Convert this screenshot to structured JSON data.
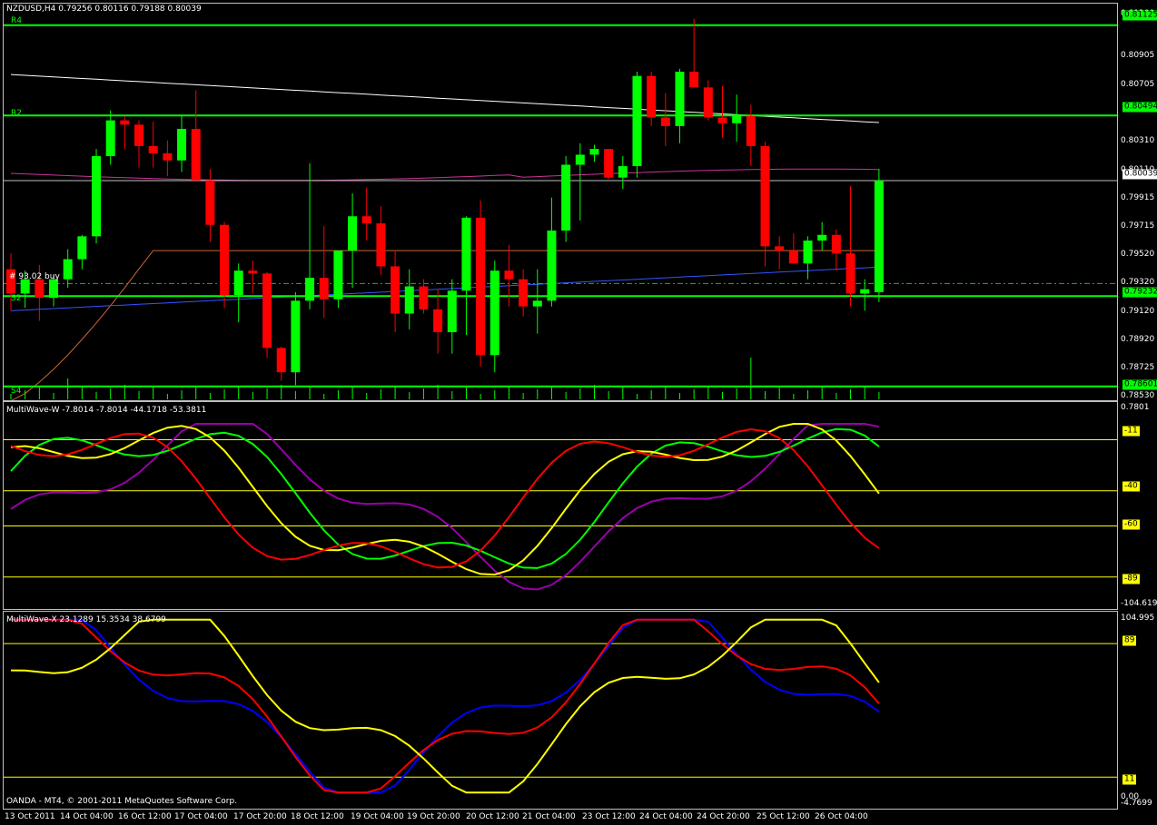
{
  "window": {
    "symbol_title": "NZDUSD,H4  0.79256 0.80116 0.79188 0.80039",
    "copyright": "OANDA - MT4, © 2001-2011 MetaQuotes Software Corp."
  },
  "colors": {
    "bull": "#00ff00",
    "bear": "#ff0000",
    "level": "#00ff00",
    "ind_level": "#ffff00",
    "purple": "#9900aa",
    "blue": "#0000ff",
    "yellow": "#ffff00",
    "red": "#ff0000",
    "green": "#00ff00"
  },
  "price_panel": {
    "ticks": [
      "0.81200",
      "0.80905",
      "0.80705",
      "0.80310",
      "0.80110",
      "0.79915",
      "0.79715",
      "0.79520",
      "0.79320",
      "0.79120",
      "0.78920",
      "0.78725",
      "0.78530"
    ],
    "level_labels": {
      "r4": "R4",
      "r2": "R2",
      "s2": "S2",
      "s4": "S4"
    },
    "level_tags": {
      "r4": "0.81125",
      "r2": "0.80494",
      "bid": "0.80039",
      "s2": "0.79232",
      "s4": "0.78601"
    },
    "order_label": "#   93.02 buy"
  },
  "wave_w": {
    "title": "MultiWave-W -7.8014 -7.8014 -44.1718 -53.3811",
    "top_value": "0.7801",
    "bottom_value": "-104.619",
    "levels": [
      "-11",
      "-40",
      "-60",
      "-89"
    ]
  },
  "wave_x": {
    "title": "MultiWave-X 23.1289 15.3534 38.6799",
    "top_value": "104.995",
    "bottom_value": "-4.7699",
    "zero_value": "0.00",
    "levels": [
      "89",
      "11"
    ]
  },
  "x_axis": [
    "13 Oct 2011",
    "14 Oct 04:00",
    "16 Oct 12:00",
    "17 Oct 04:00",
    "17 Oct 20:00",
    "18 Oct 12:00",
    "19 Oct 04:00",
    "19 Oct 20:00",
    "20 Oct 12:00",
    "21 Oct 04:00",
    "23 Oct 12:00",
    "24 Oct 04:00",
    "24 Oct 20:00",
    "25 Oct 12:00",
    "26 Oct 04:00"
  ],
  "chart_data": {
    "type": "candlestick",
    "symbol": "NZDUSD",
    "timeframe": "H4",
    "ylim": [
      0.7853,
      0.8125
    ],
    "levels": {
      "R4": 0.81125,
      "R2": 0.80494,
      "S2": 0.79232,
      "S4": 0.78601,
      "bid": 0.80039,
      "order": 0.7932
    },
    "candles": [
      [
        0.7942,
        0.7953,
        0.7913,
        0.7925
      ],
      [
        0.7925,
        0.7941,
        0.7915,
        0.7935
      ],
      [
        0.7935,
        0.7945,
        0.7906,
        0.7922
      ],
      [
        0.7922,
        0.7938,
        0.7916,
        0.7935
      ],
      [
        0.7935,
        0.7956,
        0.7929,
        0.7949
      ],
      [
        0.7949,
        0.7966,
        0.7942,
        0.7965
      ],
      [
        0.7965,
        0.8026,
        0.796,
        0.8021
      ],
      [
        0.8021,
        0.8053,
        0.8015,
        0.8046
      ],
      [
        0.8046,
        0.8049,
        0.8026,
        0.8043
      ],
      [
        0.8043,
        0.8046,
        0.8013,
        0.8028
      ],
      [
        0.8028,
        0.8045,
        0.8013,
        0.8023
      ],
      [
        0.8023,
        0.8032,
        0.8007,
        0.8018
      ],
      [
        0.8018,
        0.8049,
        0.801,
        0.804
      ],
      [
        0.804,
        0.8067,
        0.8008,
        0.8004
      ],
      [
        0.8004,
        0.8012,
        0.7961,
        0.7973
      ],
      [
        0.7973,
        0.7975,
        0.7915,
        0.7924
      ],
      [
        0.7924,
        0.7946,
        0.7905,
        0.7941
      ],
      [
        0.7941,
        0.7948,
        0.7925,
        0.7939
      ],
      [
        0.7939,
        0.794,
        0.788,
        0.7887
      ],
      [
        0.7887,
        0.7888,
        0.7864,
        0.787
      ],
      [
        0.787,
        0.7926,
        0.7861,
        0.792
      ],
      [
        0.792,
        0.8016,
        0.7914,
        0.7936
      ],
      [
        0.7936,
        0.7972,
        0.7908,
        0.7921
      ],
      [
        0.7921,
        0.7955,
        0.7915,
        0.7955
      ],
      [
        0.7955,
        0.7995,
        0.7929,
        0.7979
      ],
      [
        0.7979,
        0.7999,
        0.7962,
        0.7974
      ],
      [
        0.7974,
        0.7986,
        0.7938,
        0.7944
      ],
      [
        0.7944,
        0.7955,
        0.7898,
        0.7911
      ],
      [
        0.7911,
        0.7942,
        0.79,
        0.793
      ],
      [
        0.793,
        0.7935,
        0.7911,
        0.7914
      ],
      [
        0.7914,
        0.7928,
        0.7883,
        0.7898
      ],
      [
        0.7898,
        0.7935,
        0.7883,
        0.7927
      ],
      [
        0.7927,
        0.7979,
        0.7896,
        0.7978
      ],
      [
        0.7978,
        0.799,
        0.7874,
        0.7882
      ],
      [
        0.7882,
        0.7948,
        0.787,
        0.7941
      ],
      [
        0.7941,
        0.7959,
        0.7916,
        0.7935
      ],
      [
        0.7935,
        0.7942,
        0.7909,
        0.7916
      ],
      [
        0.7916,
        0.7942,
        0.7897,
        0.792
      ],
      [
        0.792,
        0.7992,
        0.7916,
        0.7969
      ],
      [
        0.7969,
        0.8021,
        0.7961,
        0.8015
      ],
      [
        0.8015,
        0.803,
        0.7976,
        0.8022
      ],
      [
        0.8022,
        0.8029,
        0.8017,
        0.8026
      ],
      [
        0.8026,
        0.8026,
        0.8005,
        0.8006
      ],
      [
        0.8006,
        0.8021,
        0.7998,
        0.8014
      ],
      [
        0.8014,
        0.808,
        0.8006,
        0.8077
      ],
      [
        0.8077,
        0.808,
        0.8042,
        0.8048
      ],
      [
        0.8048,
        0.8065,
        0.8028,
        0.8042
      ],
      [
        0.8042,
        0.8082,
        0.803,
        0.808
      ],
      [
        0.808,
        0.8117,
        0.8072,
        0.8069
      ],
      [
        0.8069,
        0.8074,
        0.8046,
        0.8048
      ],
      [
        0.8048,
        0.807,
        0.8034,
        0.8044
      ],
      [
        0.8044,
        0.8064,
        0.8031,
        0.8049
      ],
      [
        0.8049,
        0.8057,
        0.8014,
        0.8028
      ],
      [
        0.8028,
        0.8031,
        0.7944,
        0.7958
      ],
      [
        0.7958,
        0.7965,
        0.7942,
        0.7955
      ],
      [
        0.7955,
        0.7967,
        0.7946,
        0.7946
      ],
      [
        0.7946,
        0.7965,
        0.7935,
        0.7962
      ],
      [
        0.7962,
        0.7975,
        0.7955,
        0.7966
      ],
      [
        0.7966,
        0.797,
        0.7941,
        0.7953
      ],
      [
        0.7953,
        0.8,
        0.7916,
        0.7925
      ],
      [
        0.7925,
        0.7935,
        0.7913,
        0.7928
      ],
      [
        0.7926,
        0.8012,
        0.7919,
        0.8004
      ]
    ]
  }
}
